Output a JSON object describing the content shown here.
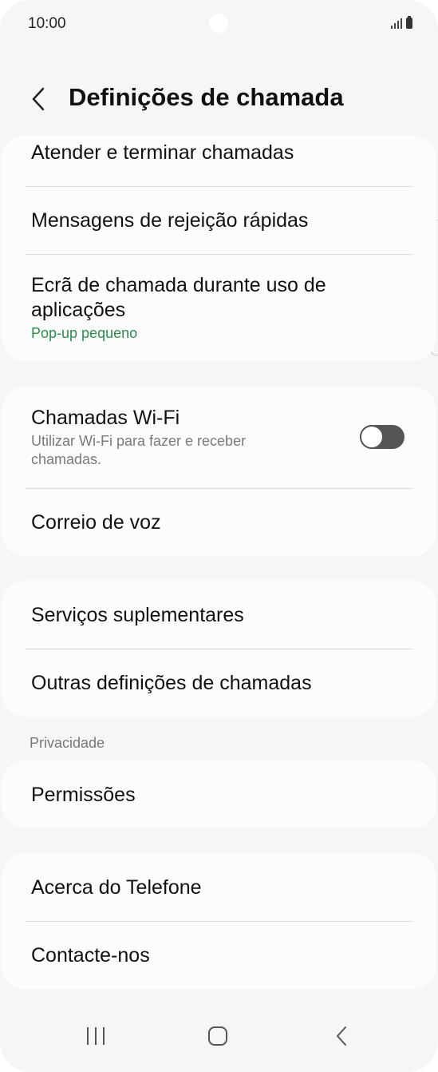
{
  "status_bar": {
    "time": "10:00",
    "signal_icon": "signal-icon",
    "battery_icon": "battery-icon"
  },
  "header": {
    "title": "Definições de chamada",
    "back_icon": "chevron-left-icon"
  },
  "cards": {
    "card1": {
      "answer_end": {
        "title": "Atender e terminar chamadas"
      },
      "quick_decline": {
        "title": "Mensagens de rejeição rápidas"
      },
      "call_display": {
        "title_line1": "Ecrã de chamada durante uso de",
        "title_line2": "aplicações",
        "value": "Pop-up pequeno"
      }
    },
    "card2": {
      "wifi_calling": {
        "title": "Chamadas Wi-Fi",
        "subtitle_line1": "Utilizar Wi-Fi para fazer e receber",
        "subtitle_line2": "chamadas.",
        "toggle_on": false
      },
      "voicemail": {
        "title": "Correio de voz"
      }
    },
    "card3": {
      "supplementary": {
        "title": "Serviços suplementares"
      },
      "other_settings": {
        "title": "Outras definições de chamadas"
      }
    },
    "privacy_label": "Privacidade",
    "card4": {
      "permissions": {
        "title": "Permissões"
      }
    },
    "card5": {
      "about_phone": {
        "title": "Acerca do Telefone"
      },
      "contact_us": {
        "title": "Contacte-nos"
      }
    }
  },
  "nav_bar": {
    "recents_icon": "recents-icon",
    "home_icon": "home-icon",
    "back_icon": "back-icon"
  },
  "colors": {
    "accent_green": "#2e8a4e",
    "background": "#f6f6f6",
    "card": "#fcfcfc"
  }
}
